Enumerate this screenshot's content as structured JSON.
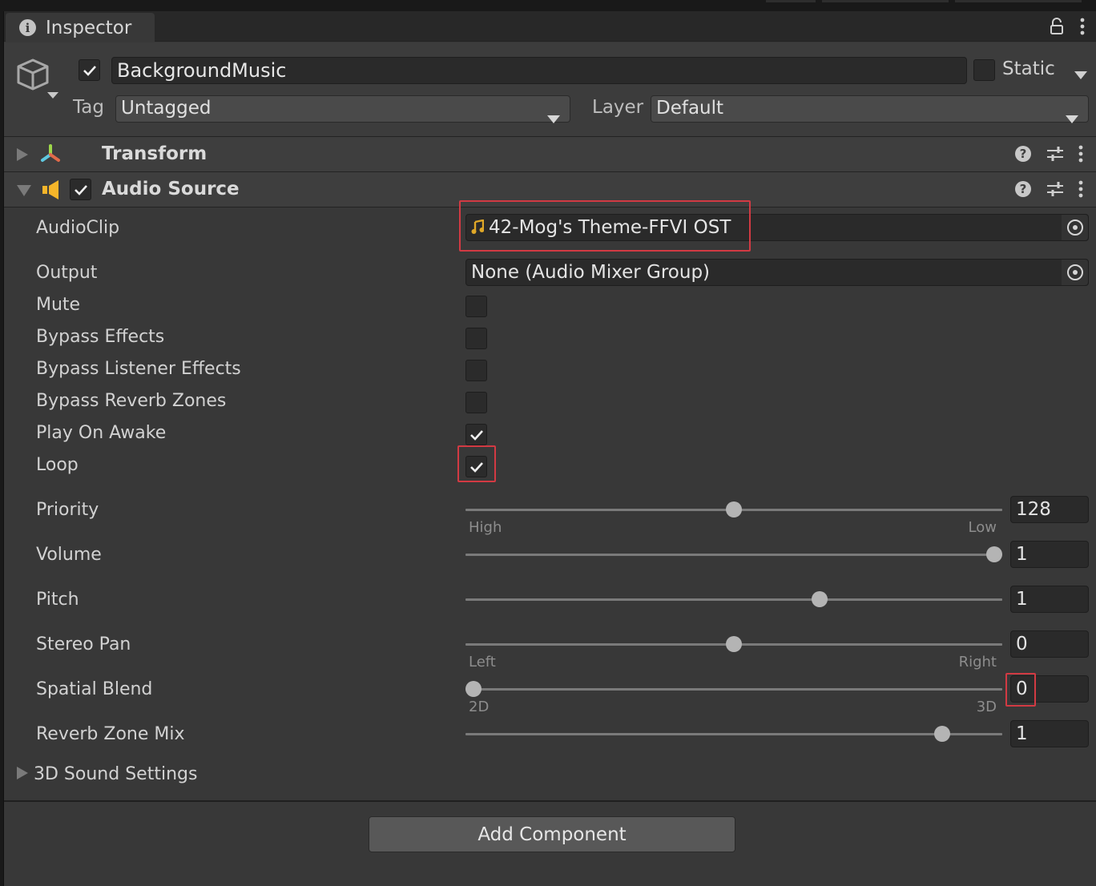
{
  "window": {
    "tab_label": "Inspector",
    "tab_icon": "info-icon",
    "header_icons": [
      "lock-icon",
      "kebab-menu-icon"
    ]
  },
  "gameobject": {
    "active": true,
    "name": "BackgroundMusic",
    "static": false,
    "static_label": "Static",
    "tag_label": "Tag",
    "tag_value": "Untagged",
    "layer_label": "Layer",
    "layer_value": "Default"
  },
  "components": [
    {
      "title": "Transform",
      "expanded": false,
      "icon": "transform-icon",
      "has_enable_toggle": false
    },
    {
      "title": "Audio Source",
      "expanded": true,
      "icon": "audio-source-icon",
      "enabled": true
    }
  ],
  "header_actions": [
    "help-icon",
    "presets-icon",
    "kebab-menu-icon"
  ],
  "audio_source": {
    "audio_clip": {
      "label": "AudioClip",
      "value": "42-Mog's Theme-FFVI OST",
      "icon": "music-note-icon"
    },
    "output": {
      "label": "Output",
      "value": "None (Audio Mixer Group)"
    },
    "toggles": [
      {
        "label": "Mute",
        "checked": false
      },
      {
        "label": "Bypass Effects",
        "checked": false
      },
      {
        "label": "Bypass Listener Effects",
        "checked": false
      },
      {
        "label": "Bypass Reverb Zones",
        "checked": false
      },
      {
        "label": "Play On Awake",
        "checked": true
      },
      {
        "label": "Loop",
        "checked": true
      }
    ],
    "sliders": [
      {
        "label": "Priority",
        "value": "128",
        "fraction": 0.5,
        "min_caption": "High",
        "max_caption": "Low"
      },
      {
        "label": "Volume",
        "value": "1",
        "fraction": 1.0
      },
      {
        "label": "Pitch",
        "value": "1",
        "fraction": 0.665
      },
      {
        "label": "Stereo Pan",
        "value": "0",
        "fraction": 0.5,
        "min_caption": "Left",
        "max_caption": "Right"
      },
      {
        "label": "Spatial Blend",
        "value": "0",
        "fraction": 0.0,
        "min_caption": "2D",
        "max_caption": "3D"
      },
      {
        "label": "Reverb Zone Mix",
        "value": "1",
        "fraction": 0.9
      }
    ],
    "sound_settings_foldout": "3D Sound Settings"
  },
  "add_component_label": "Add Component",
  "colors": {
    "highlight": "#d23a43",
    "audio_icon": "#f5b52a",
    "panel_bg": "#383838"
  }
}
